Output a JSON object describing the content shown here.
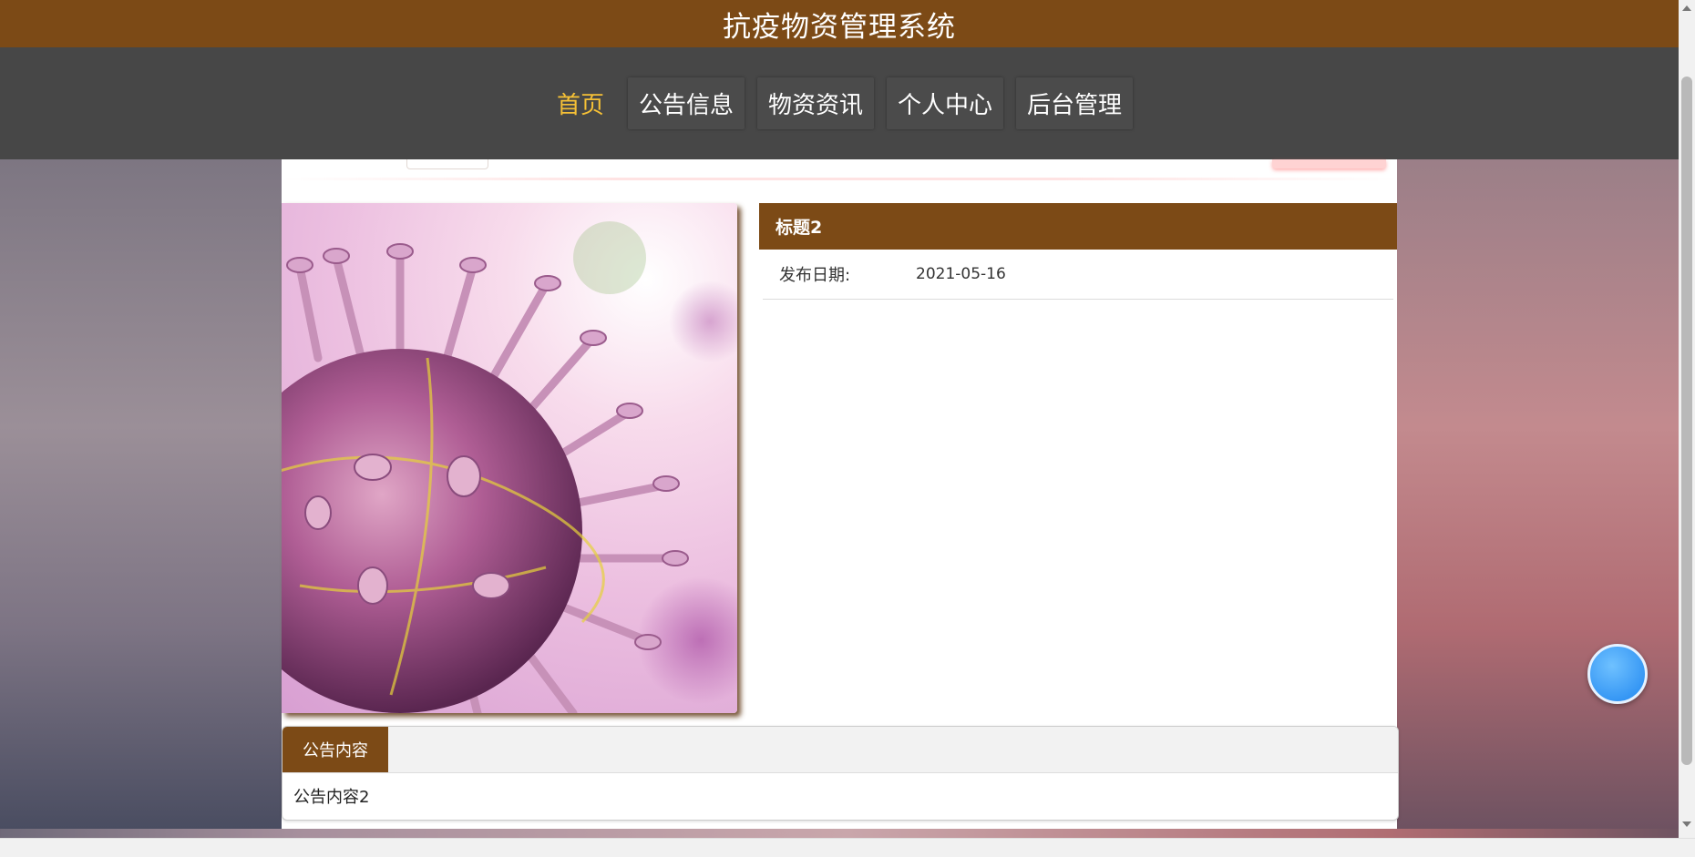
{
  "header": {
    "title": "抗疫物资管理系统"
  },
  "nav": {
    "items": [
      {
        "label": "首页",
        "active": true
      },
      {
        "label": "公告信息",
        "active": false
      },
      {
        "label": "物资资讯",
        "active": false
      },
      {
        "label": "个人中心",
        "active": false
      },
      {
        "label": "后台管理",
        "active": false
      }
    ]
  },
  "detail": {
    "title": "标题2",
    "date_label": "发布日期:",
    "date_value": "2021-05-16",
    "image_icon": "virus-illustration"
  },
  "notice": {
    "tab_label": "公告内容",
    "content": "公告内容2"
  },
  "colors": {
    "brand_brown": "#7c4a16",
    "nav_bg": "#474747",
    "nav_active": "#f5c036",
    "float_button": "#1f86f0"
  },
  "icons": {
    "float_button": "float-action-icon"
  }
}
